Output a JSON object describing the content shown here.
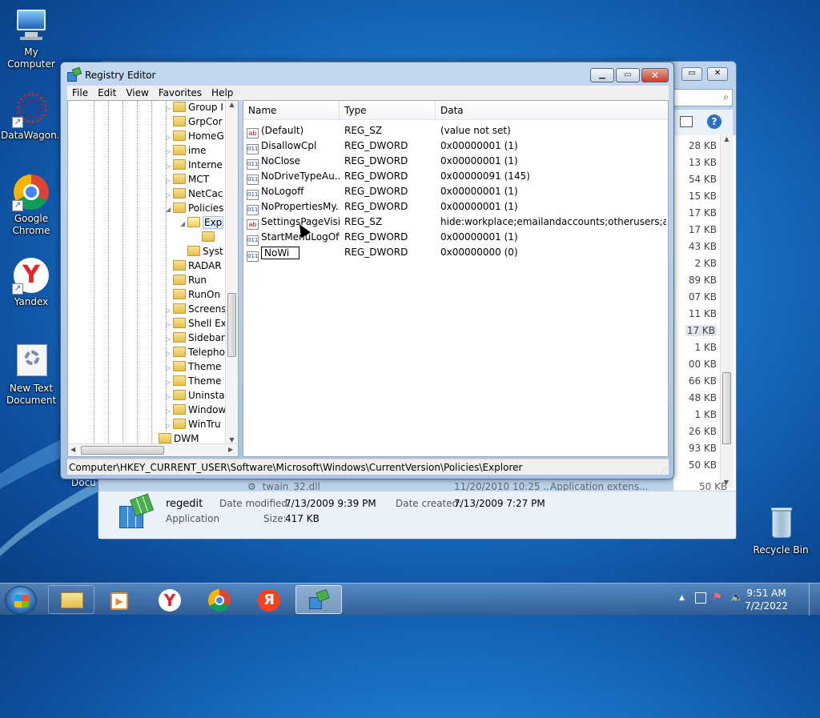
{
  "desktop": {
    "icons": [
      {
        "label": "My Computer"
      },
      {
        "label": "DataWagon..."
      },
      {
        "label": "Google Chrome"
      },
      {
        "label": "Yandex"
      },
      {
        "label": "New Text Document"
      },
      {
        "label": "Recycle Bin"
      }
    ]
  },
  "explorer": {
    "sizes": [
      "28 KB",
      "13 KB",
      "54 KB",
      "15 KB",
      "17 KB",
      "17 KB",
      "43 KB",
      "2 KB",
      "89 KB",
      "07 KB",
      "11 KB",
      "17 KB",
      "1 KB",
      "00 KB",
      "66 KB",
      "48 KB",
      "1 KB",
      "26 KB",
      "93 KB",
      "50 KB"
    ],
    "partial_row": {
      "name": "twain_32.dll",
      "date": "11/20/2010 10:25 ...",
      "type": "Application extens...",
      "size": "50 KB"
    },
    "left_stub": "Docu",
    "details": {
      "name": "regedit",
      "kind": "Application",
      "modified_label": "Date modified:",
      "modified_value": "7/13/2009 9:39 PM",
      "created_label": "Date created:",
      "created_value": "7/13/2009 7:27 PM",
      "size_label": "Size:",
      "size_value": "417 KB"
    }
  },
  "regedit": {
    "title": "Registry Editor",
    "menu": [
      "File",
      "Edit",
      "View",
      "Favorites",
      "Help"
    ],
    "tree": [
      {
        "label": "Group I"
      },
      {
        "label": "GrpCor"
      },
      {
        "label": "HomeG"
      },
      {
        "label": "ime"
      },
      {
        "label": "Interne"
      },
      {
        "label": "MCT"
      },
      {
        "label": "NetCac"
      },
      {
        "label": "Policies"
      },
      {
        "label": "Exp"
      },
      {
        "label": ""
      },
      {
        "label": "Syst"
      },
      {
        "label": "RADAR"
      },
      {
        "label": "Run"
      },
      {
        "label": "RunOn"
      },
      {
        "label": "Screens"
      },
      {
        "label": "Shell Ex"
      },
      {
        "label": "Sidebar"
      },
      {
        "label": "Telepho"
      },
      {
        "label": "Theme"
      },
      {
        "label": "Theme"
      },
      {
        "label": "Uninsta"
      },
      {
        "label": "Window"
      },
      {
        "label": "WinTru"
      },
      {
        "label": "DWM"
      }
    ],
    "columns": {
      "name": "Name",
      "type": "Type",
      "data": "Data"
    },
    "values": [
      {
        "name": "(Default)",
        "type": "REG_SZ",
        "data": "(value not set)",
        "icon": "string"
      },
      {
        "name": "DisallowCpl",
        "type": "REG_DWORD",
        "data": "0x00000001 (1)",
        "icon": "binary"
      },
      {
        "name": "NoClose",
        "type": "REG_DWORD",
        "data": "0x00000001 (1)",
        "icon": "binary"
      },
      {
        "name": "NoDriveTypeAu...",
        "type": "REG_DWORD",
        "data": "0x00000091 (145)",
        "icon": "binary"
      },
      {
        "name": "NoLogoff",
        "type": "REG_DWORD",
        "data": "0x00000001 (1)",
        "icon": "binary"
      },
      {
        "name": "NoPropertiesMy...",
        "type": "REG_DWORD",
        "data": "0x00000001 (1)",
        "icon": "binary"
      },
      {
        "name": "SettingsPageVisi...",
        "type": "REG_SZ",
        "data": "hide:workplace;emailandaccounts;otherusers;assig...",
        "icon": "string"
      },
      {
        "name": "StartMenuLogOff",
        "type": "REG_DWORD",
        "data": "0x00000001 (1)",
        "icon": "binary"
      },
      {
        "name": "NoWi",
        "type": "REG_DWORD",
        "data": "0x00000000 (0)",
        "icon": "binary",
        "editing": true
      }
    ],
    "status_path": "Computer\\HKEY_CURRENT_USER\\Software\\Microsoft\\Windows\\CurrentVersion\\Policies\\Explorer"
  },
  "taskbar": {
    "time": "9:51 AM",
    "date": "7/2/2022"
  },
  "colors": {
    "selection": "#3399ff",
    "folder": "#e6be4c",
    "taskbar": "#3c6496"
  }
}
